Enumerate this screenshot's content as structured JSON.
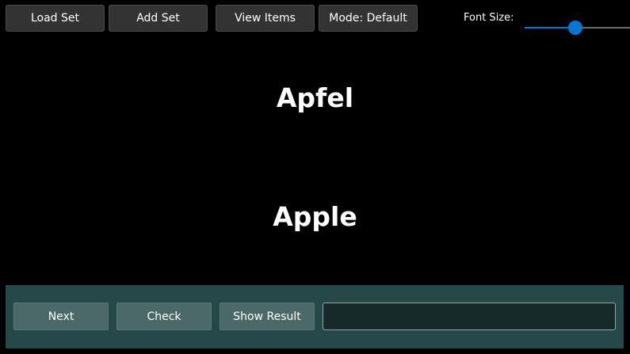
{
  "toolbar": {
    "load_set": "Load Set",
    "add_set": "Add Set",
    "view_items": "View Items",
    "mode": "Mode: Default"
  },
  "font_size": {
    "label": "Font Size:",
    "value_fraction": 0.48
  },
  "card": {
    "prompt": "Apfel",
    "answer": "Apple"
  },
  "controls": {
    "next": "Next",
    "check": "Check",
    "show_result": "Show Result",
    "input_value": "",
    "input_placeholder": ""
  },
  "colors": {
    "background": "#000000",
    "accent": "#0078d4",
    "panel": "#264848"
  }
}
